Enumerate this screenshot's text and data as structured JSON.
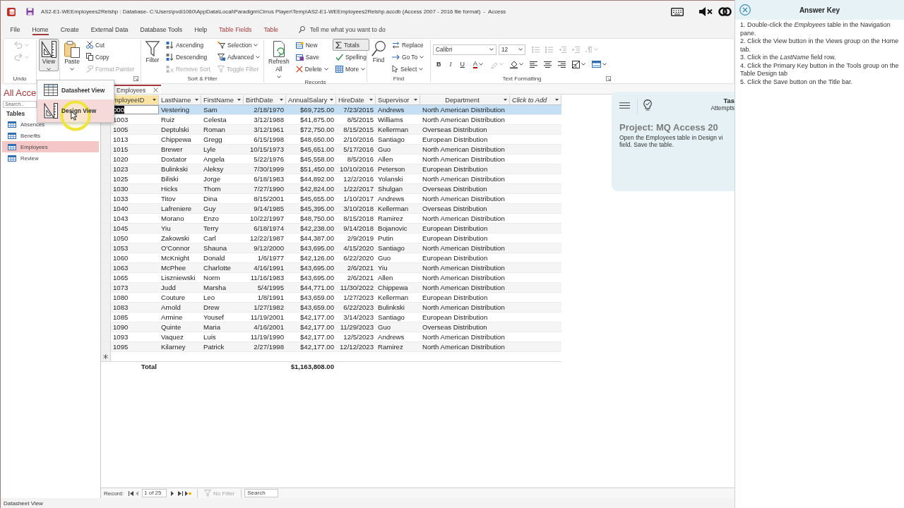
{
  "title_bar": {
    "title": "AS2-E1-WEEmployees2Relshp : Database- C:\\Users\\pvdi1060\\AppData\\Local\\Paradigm\\Cirrus Player\\Temp\\AS2-E1-WEEmployees2Relshp.accdb (Access 2007 - 2016 file format)  -  Access"
  },
  "menu_tabs": [
    {
      "label": "File",
      "selected": false,
      "kind": "main"
    },
    {
      "label": "Home",
      "selected": true,
      "kind": "main"
    },
    {
      "label": "Create",
      "selected": false,
      "kind": "main"
    },
    {
      "label": "External Data",
      "selected": false,
      "kind": "main"
    },
    {
      "label": "Database Tools",
      "selected": false,
      "kind": "main"
    },
    {
      "label": "Help",
      "selected": false,
      "kind": "main"
    },
    {
      "label": "Table Fields",
      "selected": false,
      "kind": "contextual"
    },
    {
      "label": "Table",
      "selected": false,
      "kind": "contextual"
    }
  ],
  "tell_me": {
    "placeholder": "Tell me what you want to do"
  },
  "ribbon": [
    {
      "label": "Undo",
      "launcher": false,
      "buttons": [
        {
          "kind": "small",
          "disabled": true,
          "pressed": false,
          "dropdown": true
        },
        {
          "kind": "small",
          "disabled": true,
          "pressed": false,
          "dropdown": true
        }
      ]
    },
    {
      "launcher": false,
      "buttons": [
        {
          "kind": "large",
          "label": "View",
          "disabled": false,
          "pressed": true,
          "dropdown": true
        }
      ]
    },
    {
      "launcher": true,
      "buttons": [
        {
          "kind": "large",
          "label": "Paste",
          "disabled": false,
          "pressed": false,
          "dropdown": true
        },
        {
          "kind": "small",
          "label": "Cut",
          "disabled": false,
          "pressed": false,
          "dropdown": false
        },
        {
          "kind": "small",
          "label": "Copy",
          "disabled": false,
          "pressed": false,
          "dropdown": false
        },
        {
          "kind": "small",
          "label": "Format Painter",
          "disabled": true,
          "pressed": false,
          "dropdown": false
        }
      ]
    },
    {
      "label": "Sort & Filter",
      "launcher": false,
      "buttons": [
        {
          "kind": "large",
          "label": "Filter",
          "disabled": false,
          "pressed": false,
          "dropdown": false
        },
        {
          "kind": "small",
          "label": "Ascending",
          "disabled": false,
          "pressed": false,
          "dropdown": false
        },
        {
          "kind": "small",
          "label": "Descending",
          "disabled": false,
          "pressed": false,
          "dropdown": false
        },
        {
          "kind": "small",
          "label": "Remove Sort",
          "disabled": true,
          "pressed": false,
          "dropdown": false
        },
        {
          "kind": "small",
          "label": "Selection",
          "disabled": false,
          "pressed": false,
          "dropdown": true
        },
        {
          "kind": "small",
          "label": "Advanced",
          "disabled": false,
          "pressed": false,
          "dropdown": true
        },
        {
          "kind": "small",
          "label": "Toggle Filter",
          "disabled": true,
          "pressed": false,
          "dropdown": false
        }
      ]
    },
    {
      "label": "Records",
      "launcher": false,
      "buttons": [
        {
          "kind": "large",
          "label": "Refresh All",
          "disabled": false,
          "pressed": false,
          "dropdown": true
        },
        {
          "kind": "small",
          "label": "New",
          "disabled": false,
          "pressed": false,
          "dropdown": false
        },
        {
          "kind": "small",
          "label": "Save",
          "disabled": false,
          "pressed": false,
          "dropdown": false
        },
        {
          "kind": "small",
          "label": "Delete",
          "disabled": false,
          "pressed": false,
          "dropdown": true
        },
        {
          "kind": "small",
          "label": "Totals",
          "disabled": false,
          "pressed": true,
          "dropdown": false
        },
        {
          "kind": "small",
          "label": "Spelling",
          "disabled": false,
          "pressed": false,
          "dropdown": false
        },
        {
          "kind": "small",
          "label": "More",
          "disabled": false,
          "pressed": false,
          "dropdown": true
        }
      ]
    },
    {
      "label": "Find",
      "launcher": false,
      "buttons": [
        {
          "kind": "large",
          "label": "Find",
          "disabled": false,
          "pressed": false,
          "dropdown": false
        },
        {
          "kind": "small",
          "label": "Replace",
          "disabled": false,
          "pressed": false,
          "dropdown": false
        },
        {
          "kind": "small",
          "label": "Go To",
          "disabled": false,
          "pressed": false,
          "dropdown": true
        },
        {
          "kind": "small",
          "label": "Select",
          "disabled": false,
          "pressed": false,
          "dropdown": true
        }
      ]
    },
    {
      "label": "Text Formatting",
      "launcher": true,
      "upper_row": [
        {
          "kind": "combo",
          "value": "Calibri",
          "disabled": false,
          "dropdown": true
        },
        {
          "kind": "combo",
          "value": "12",
          "disabled": false,
          "dropdown": true
        },
        {
          "kind": "icon",
          "disabled": true,
          "dropdown": false
        },
        {
          "kind": "icon",
          "disabled": true,
          "dropdown": false
        },
        {
          "kind": "icon",
          "disabled": true,
          "dropdown": false
        },
        {
          "kind": "icon",
          "disabled": true,
          "dropdown": false
        },
        {
          "kind": "icon",
          "disabled": true,
          "dropdown": true
        }
      ],
      "lower_row": [
        {
          "kind": "bold",
          "label": "B",
          "disabled": false,
          "dropdown": false
        },
        {
          "kind": "italic",
          "label": "I",
          "disabled": false,
          "dropdown": false
        },
        {
          "kind": "underline",
          "label": "U",
          "disabled": false,
          "dropdown": false
        },
        {
          "kind": "font-color",
          "label": "A",
          "disabled": false,
          "dropdown": true
        },
        {
          "kind": "icon",
          "disabled": true,
          "dropdown": true
        },
        {
          "kind": "icon",
          "disabled": false,
          "dropdown": true
        },
        {
          "kind": "icon",
          "disabled": false,
          "dropdown": false
        },
        {
          "kind": "icon",
          "disabled": false,
          "dropdown": false
        },
        {
          "kind": "icon",
          "disabled": false,
          "dropdown": false
        },
        {
          "kind": "icon",
          "disabled": false,
          "dropdown": true
        },
        {
          "kind": "icon",
          "disabled": false,
          "dropdown": true
        }
      ]
    }
  ],
  "nav_pane": {
    "title": "All Acce",
    "search": {
      "placeholder": "Search..."
    },
    "groups": [
      {
        "label": "Tables",
        "items": [
          {
            "label": "Absences",
            "selected": false
          },
          {
            "label": "Benefits",
            "selected": false
          },
          {
            "label": "Employees",
            "selected": true
          },
          {
            "label": "Review",
            "selected": false
          }
        ]
      }
    ]
  },
  "view_menu": {
    "items": [
      {
        "label": "Datasheet View",
        "hovered": false
      },
      {
        "label": "Design View",
        "hovered": true
      }
    ]
  },
  "document_tabs": [
    {
      "label": "Employees",
      "selected": true
    }
  ],
  "datasheet": {
    "columns": [
      {
        "label": "mployeeID",
        "kind": "text",
        "selected": true
      },
      {
        "label": "LastName",
        "kind": "text",
        "selected": false
      },
      {
        "label": "FirstName",
        "kind": "text",
        "selected": false
      },
      {
        "label": "BirthDate",
        "kind": "date",
        "selected": false
      },
      {
        "label": "AnnualSalary",
        "kind": "currency",
        "selected": false,
        "total": "$1,163,808.00"
      },
      {
        "label": "HireDate",
        "kind": "date",
        "selected": false
      },
      {
        "label": "Supervisor",
        "kind": "text",
        "selected": false
      },
      {
        "label": "Department",
        "kind": "lookup",
        "selected": false
      },
      {
        "label": "Click to Add",
        "kind": "add",
        "selected": false
      }
    ],
    "rows": [
      {
        "selected": true,
        "cells": [
          "000",
          "Vestering",
          "Sam",
          "2/18/1970",
          "$69,725.00",
          "7/23/2015",
          "Andrews",
          "North American Distribution"
        ]
      },
      {
        "selected": false,
        "cells": [
          "1003",
          "Ruiz",
          "Celesta",
          "3/12/1988",
          "$41,875.00",
          "8/5/2015",
          "Williams",
          "North American Distribution"
        ]
      },
      {
        "selected": false,
        "cells": [
          "1005",
          "Deptulski",
          "Roman",
          "3/12/1961",
          "$72,750.00",
          "8/15/2015",
          "Kellerman",
          "Overseas Distribution"
        ]
      },
      {
        "selected": false,
        "cells": [
          "1013",
          "Chippewa",
          "Gregg",
          "6/15/1998",
          "$48,650.00",
          "2/10/2016",
          "Santiago",
          "European Distribution"
        ]
      },
      {
        "selected": false,
        "cells": [
          "1015",
          "Brewer",
          "Lyle",
          "10/15/1973",
          "$45,651.00",
          "5/17/2016",
          "Guo",
          "North American Distribution"
        ]
      },
      {
        "selected": false,
        "cells": [
          "1020",
          "Doxtator",
          "Angela",
          "5/22/1976",
          "$45,558.00",
          "8/5/2016",
          "Allen",
          "North American Distribution"
        ]
      },
      {
        "selected": false,
        "cells": [
          "1023",
          "Bulinkski",
          "Aleksy",
          "7/30/1999",
          "$51,450.00",
          "10/10/2016",
          "Peterson",
          "European Distribution"
        ]
      },
      {
        "selected": false,
        "cells": [
          "1025",
          "Biliski",
          "Jorge",
          "6/18/1983",
          "$44,892.00",
          "12/2/2016",
          "Yolanski",
          "North American Distribution"
        ]
      },
      {
        "selected": false,
        "cells": [
          "1030",
          "Hicks",
          "Thom",
          "7/27/1990",
          "$42,824.00",
          "1/22/2017",
          "Shulgan",
          "Overseas Distribution"
        ]
      },
      {
        "selected": false,
        "cells": [
          "1033",
          "Titov",
          "Dina",
          "8/15/2001",
          "$45,655.00",
          "1/10/2017",
          "Andrews",
          "North American Distribution"
        ]
      },
      {
        "selected": false,
        "cells": [
          "1040",
          "Lafreniere",
          "Guy",
          "9/14/1985",
          "$45,395.00",
          "3/10/2018",
          "Kellerman",
          "Overseas Distribution"
        ]
      },
      {
        "selected": false,
        "cells": [
          "1043",
          "Morano",
          "Enzo",
          "10/22/1997",
          "$48,750.00",
          "8/15/2018",
          "Ramirez",
          "North American Distribution"
        ]
      },
      {
        "selected": false,
        "cells": [
          "1045",
          "Yiu",
          "Terry",
          "6/18/1974",
          "$42,238.00",
          "9/14/2018",
          "Bojanovic",
          "European Distribution"
        ]
      },
      {
        "selected": false,
        "cells": [
          "1050",
          "Zakowski",
          "Carl",
          "12/22/1987",
          "$44,387.00",
          "2/9/2019",
          "Putin",
          "European Distribution"
        ]
      },
      {
        "selected": false,
        "cells": [
          "1053",
          "O'Connor",
          "Shauna",
          "9/12/2000",
          "$43,695.00",
          "4/15/2020",
          "Santiago",
          "North American Distribution"
        ]
      },
      {
        "selected": false,
        "cells": [
          "1060",
          "McKnight",
          "Donald",
          "1/6/1977",
          "$42,126.00",
          "6/22/2020",
          "Guo",
          "European Distribution"
        ]
      },
      {
        "selected": false,
        "cells": [
          "1063",
          "McPhee",
          "Charlotte",
          "4/16/1991",
          "$43,695.00",
          "2/6/2021",
          "Yiu",
          "North American Distribution"
        ]
      },
      {
        "selected": false,
        "cells": [
          "1065",
          "Liszniewski",
          "Norm",
          "11/16/1983",
          "$43,695.00",
          "2/6/2021",
          "Allen",
          "North American Distribution"
        ]
      },
      {
        "selected": false,
        "cells": [
          "1073",
          "Judd",
          "Marsha",
          "5/4/1995",
          "$44,771.00",
          "11/30/2022",
          "Chippewa",
          "North American Distribution"
        ]
      },
      {
        "selected": false,
        "cells": [
          "1080",
          "Couture",
          "Leo",
          "1/8/1991",
          "$43,659.00",
          "1/27/2023",
          "Kellerman",
          "European Distribution"
        ]
      },
      {
        "selected": false,
        "cells": [
          "1083",
          "Arnold",
          "Drew",
          "1/27/1982",
          "$43,659.00",
          "6/22/2023",
          "Bulinkski",
          "North American Distribution"
        ]
      },
      {
        "selected": false,
        "cells": [
          "1085",
          "Armine",
          "Yousef",
          "11/19/2001",
          "$42,177.00",
          "3/14/2023",
          "Santiago",
          "European Distribution"
        ]
      },
      {
        "selected": false,
        "cells": [
          "1090",
          "Quinte",
          "Maria",
          "4/16/2001",
          "$42,177.00",
          "11/29/2023",
          "Guo",
          "Overseas Distribution"
        ]
      },
      {
        "selected": false,
        "cells": [
          "1093",
          "Vaquez",
          "Luis",
          "11/19/1990",
          "$42,177.00",
          "12/5/2023",
          "Andrews",
          "North American Distribution"
        ]
      },
      {
        "selected": false,
        "cells": [
          "1095",
          "Kilarney",
          "Patrick",
          "2/27/1998",
          "$42,177.00",
          "12/12/2023",
          "Ramirez",
          "North American Distribution"
        ]
      }
    ],
    "total_row": {
      "label": "Total"
    }
  },
  "record_navigator": {
    "label": "Record:",
    "position": "1 of 25",
    "nav_buttons": [
      {
        "disabled": false
      },
      {
        "disabled": true
      },
      {
        "disabled": false
      },
      {
        "disabled": false
      },
      {
        "disabled": false
      }
    ],
    "filter": {
      "label": "No Filter",
      "disabled": true
    },
    "search": {
      "placeholder": "Search"
    }
  },
  "status_bar": {
    "text": "Datasheet View"
  },
  "task_card": {
    "title": "Tas",
    "attempts": "Attempts",
    "project": "Project: MQ Access 20",
    "description": [
      "Open the Employees table in Design vi",
      "field. Save the table."
    ]
  },
  "answer_key": {
    "title": "Answer Key",
    "steps": [
      "1. Double-click the *Employees* table in the Navigation pane.",
      "2. Click the View button in the Views group on the Home tab.",
      "3. Click in the *LastName* field row.",
      "4. Click the Primary Key button in the Tools group on the Table Design tab",
      "5. Click the Save button on the Title bar."
    ]
  }
}
